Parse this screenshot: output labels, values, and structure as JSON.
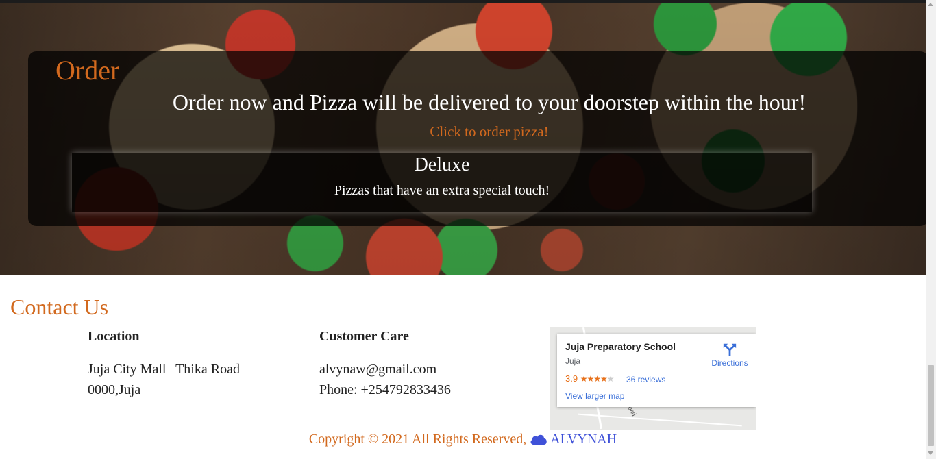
{
  "order": {
    "title": "Order",
    "lead": "Order now and Pizza will be delivered to your doorstep within the hour!",
    "link": "Click to order pizza!",
    "deluxe_title": "Deluxe",
    "deluxe_desc": "Pizzas that have an extra special touch!"
  },
  "contact": {
    "title": "Contact Us",
    "location_heading": "Location",
    "location_line1": "Juja City Mall | Thika Road",
    "location_line2": "0000,Juja",
    "care_heading": "Customer Care",
    "care_email": "alvynaw@gmail.com",
    "care_phone": "Phone: +254792833436"
  },
  "map": {
    "place_name": "Juja Preparatory School",
    "area": "Juja",
    "rating": "3.9",
    "stars_filled": 4,
    "reviews": "36 reviews",
    "view_larger": "View larger map",
    "directions": "Directions",
    "road_label": "oad"
  },
  "footer": {
    "copyright": "Copyright © 2021 All Rights Reserved,",
    "brand": "ALVYNAH"
  },
  "colors": {
    "accent": "#d2691e",
    "brand": "#3f51d8"
  },
  "icons": {
    "directions": "directions-icon",
    "brand": "cloud-icon"
  }
}
